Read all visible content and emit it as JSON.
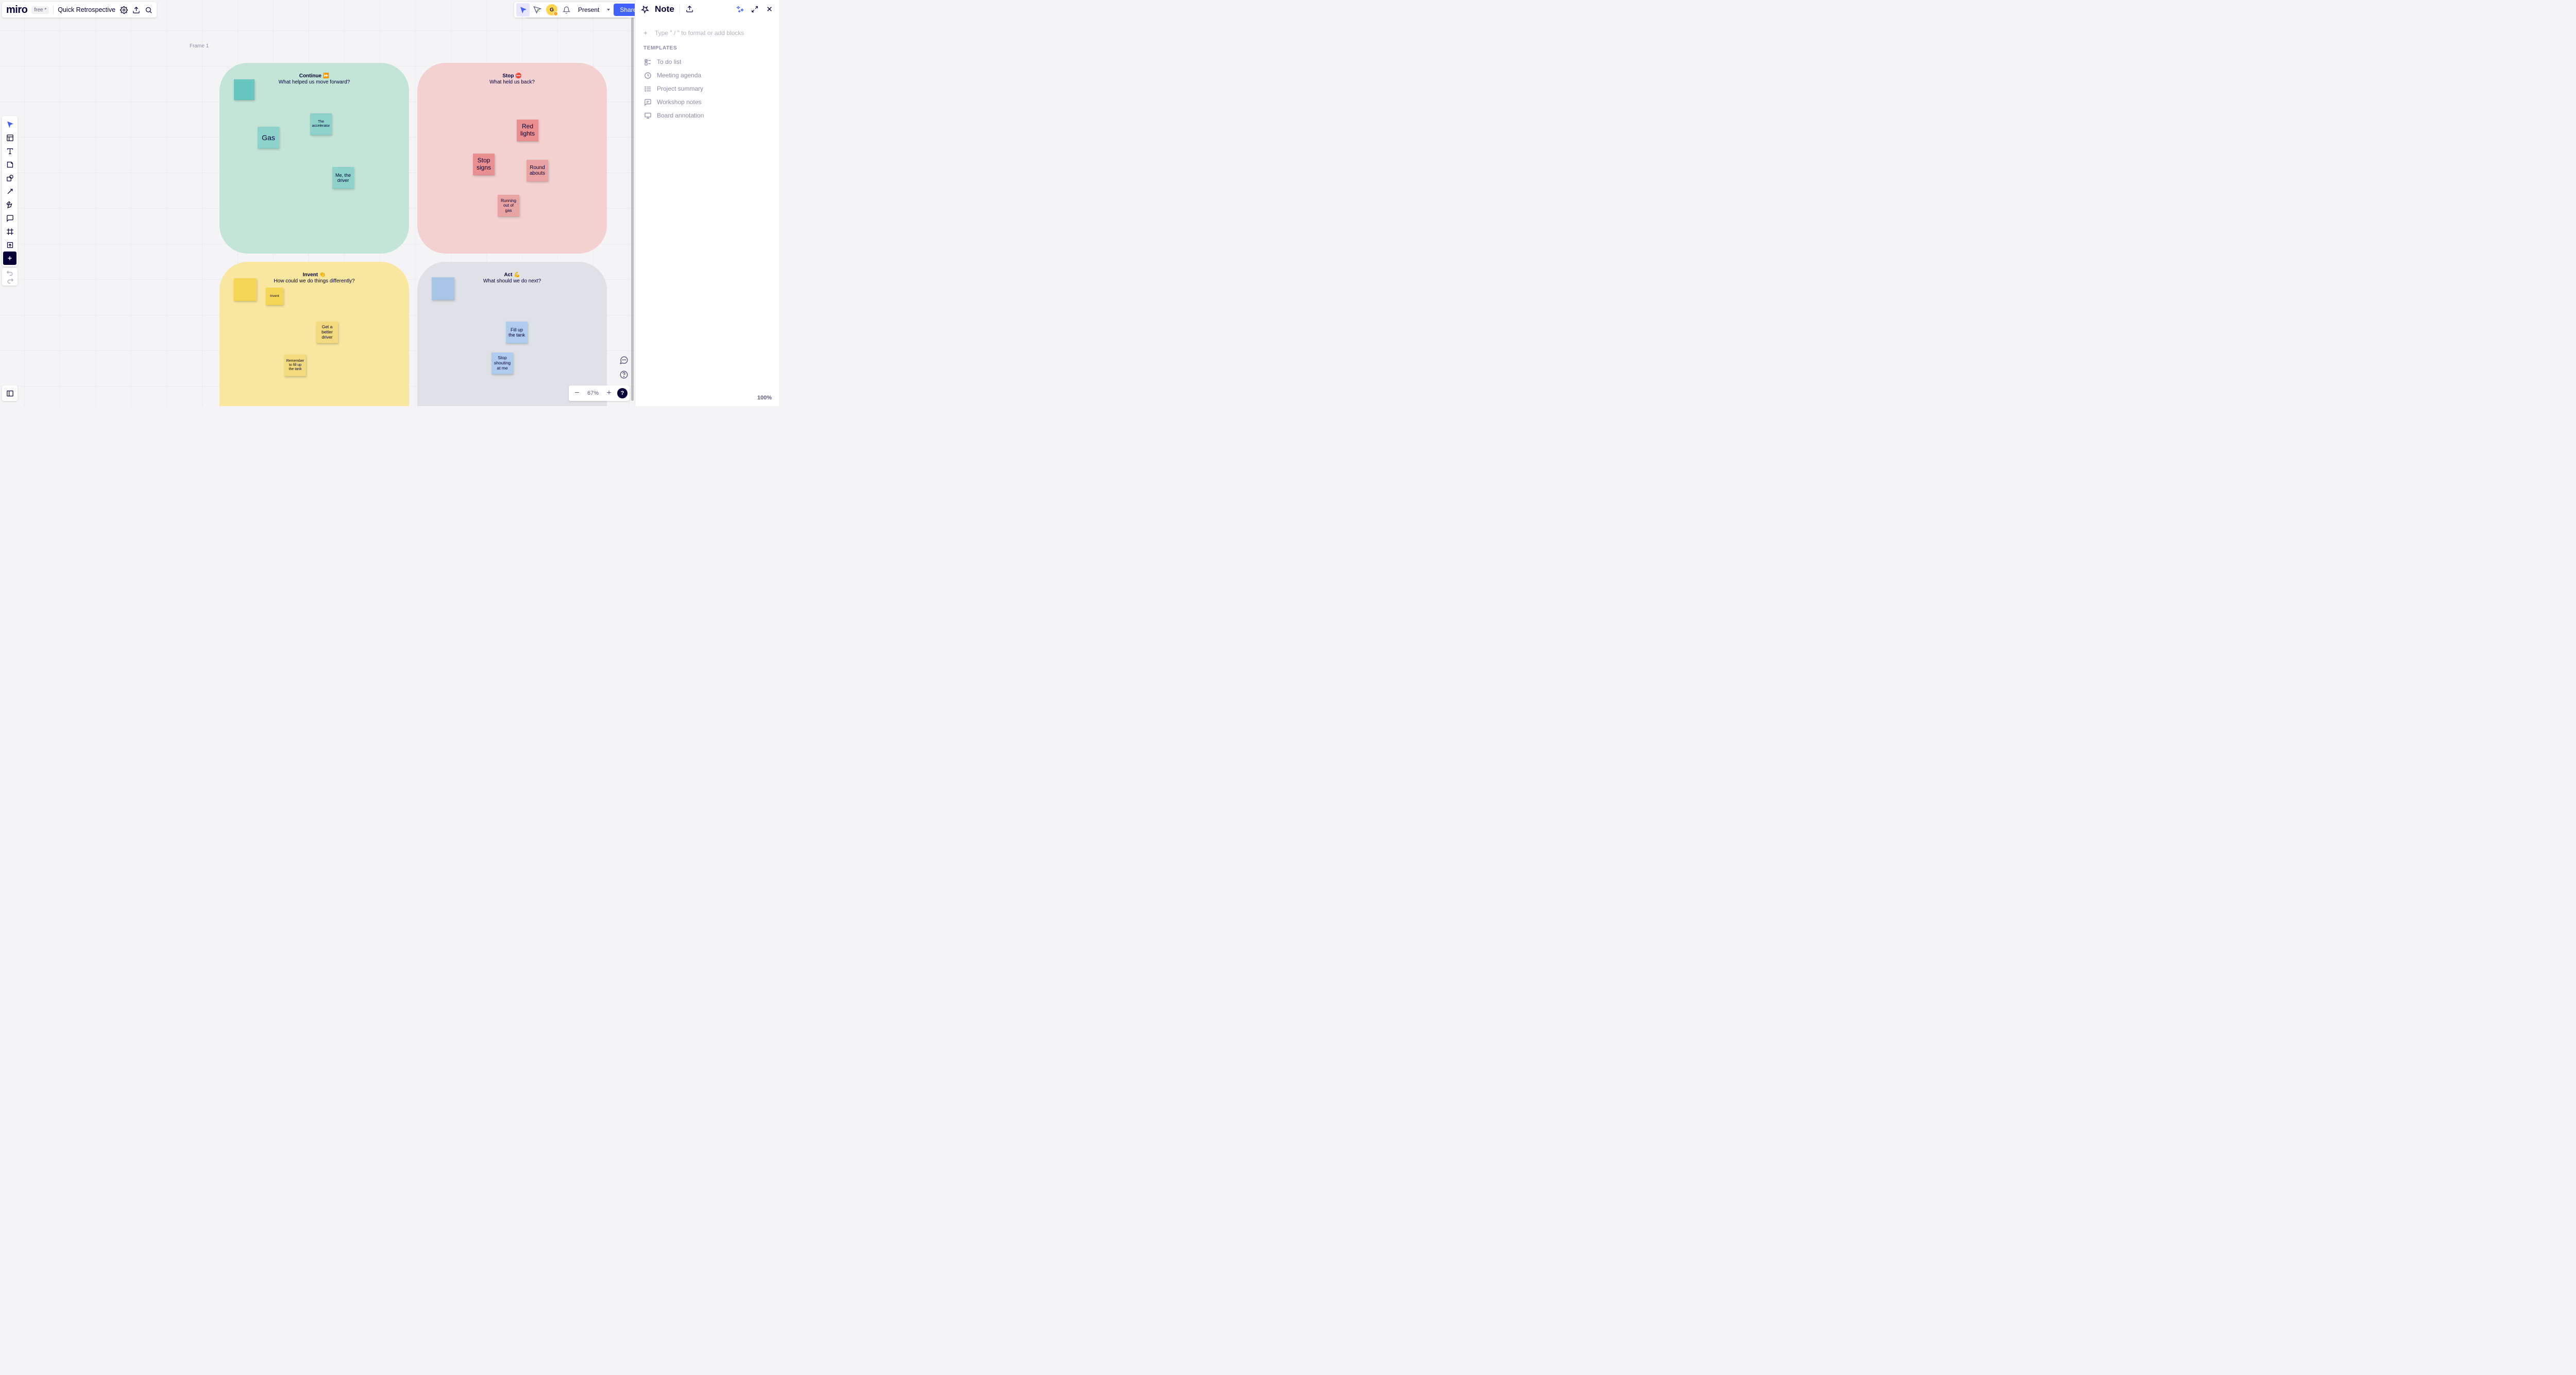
{
  "app": {
    "logo": "miro",
    "plan": "free *",
    "board": "Quick Retrospective"
  },
  "topbar": {
    "present": "Present",
    "share": "Share"
  },
  "canvas": {
    "frame_label": "Frame 1",
    "quadrants": {
      "continue": {
        "title": "Continue ⏩",
        "subtitle": "What helped us move forward?"
      },
      "stop": {
        "title": "Stop ⛔",
        "subtitle": "What held us back?"
      },
      "invent": {
        "title": "Invent 👏",
        "subtitle": "How could we do things differently?"
      },
      "act": {
        "title": "Act 💪",
        "subtitle": "What should we do next?"
      }
    },
    "stickies": {
      "continue_blank": "",
      "gas": "Gas",
      "accelerator": "The accelerator",
      "me_driver": "Me, the driver",
      "red_lights": "Red lights",
      "stop_signs": "Stop signs",
      "round_abouts": "Round abouts",
      "running_out": "Running out of gas",
      "invent_blank": "",
      "invent_small": "Invent",
      "better_driver": "Get a better driver",
      "remember_fill": "Remember to fill up the tank",
      "act_blank": "",
      "fill_tank": "Fill up the tank",
      "stop_shouting": "Stop shouting at me"
    }
  },
  "notes": {
    "title": "Note",
    "placeholder": "Type \" / \" to format or add blocks",
    "templates_header": "TEMPLATES",
    "templates": {
      "todo": "To do list",
      "agenda": "Meeting agenda",
      "summary": "Project summary",
      "workshop": "Workshop notes",
      "board": "Board annotation"
    },
    "zoom_footer": "100%"
  },
  "zoom": {
    "level": "67%",
    "help": "?"
  }
}
